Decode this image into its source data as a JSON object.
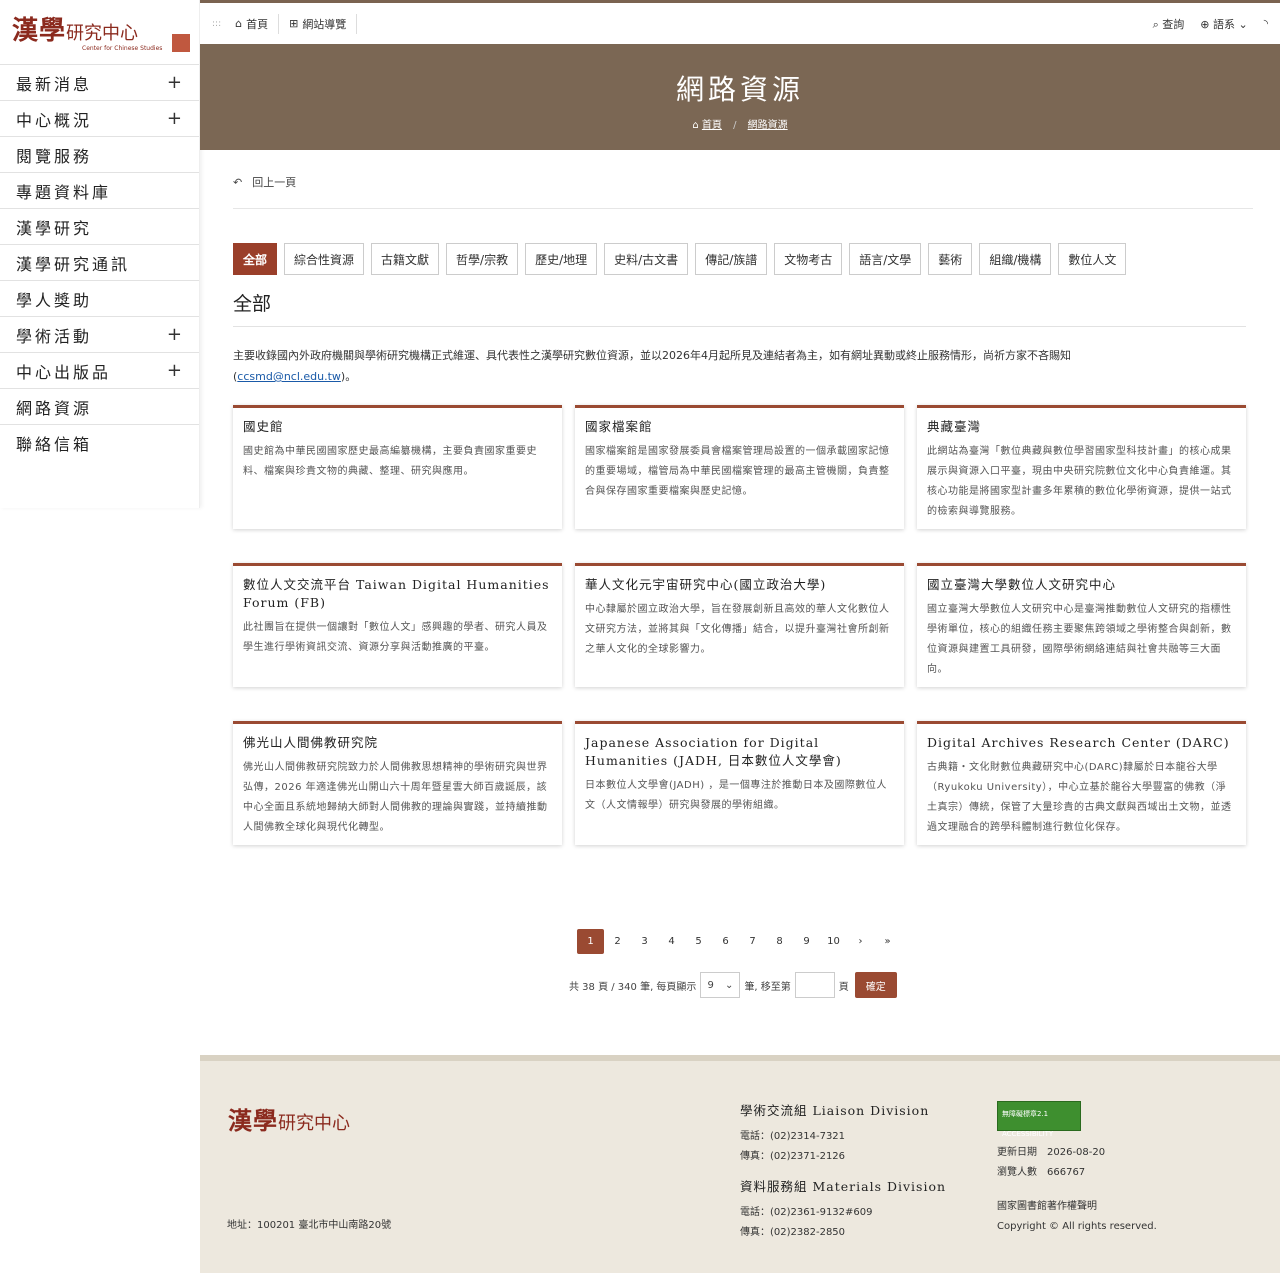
{
  "logo": {
    "zh": "漢學",
    "zh2": "研究中心",
    "en": "Center for Chinese Studies"
  },
  "sidebar": [
    {
      "label": "最新消息",
      "expand": "+"
    },
    {
      "label": "中心概況",
      "expand": "+"
    },
    {
      "label": "閱覽服務",
      "expand": ""
    },
    {
      "label": "專題資料庫",
      "expand": ""
    },
    {
      "label": "漢學研究",
      "expand": ""
    },
    {
      "label": "漢學研究通訊",
      "expand": ""
    },
    {
      "label": "學人獎助",
      "expand": ""
    },
    {
      "label": "學術活動",
      "expand": "+"
    },
    {
      "label": "中心出版品",
      "expand": "+"
    },
    {
      "label": "網路資源",
      "expand": ""
    },
    {
      "label": "聯絡信箱",
      "expand": ""
    }
  ],
  "topbar": {
    "home": "首頁",
    "sitemap": "網站導覽",
    "search": "查詢",
    "language": "語系"
  },
  "banner": {
    "title": "網路資源",
    "crumb_home": "首頁",
    "crumb_current": "網路資源"
  },
  "main": {
    "back": "回上一頁",
    "filters": [
      "全部",
      "綜合性資源",
      "古籍文獻",
      "哲學/宗教",
      "歷史/地理",
      "史料/古文書",
      "傳記/族譜",
      "文物考古",
      "語言/文學",
      "藝術",
      "組織/機構",
      "數位人文"
    ],
    "section_title": "全部",
    "intro": "主要收錄國內外政府機關與學術研究機構正式維運、具代表性之漢學研究數位資源，並以2026年4月起所見及連結者為主，如有網址異動或終止服務情形，尚祈方家不吝賜知",
    "intro_email": "ccsmd@ncl.edu.tw",
    "intro_tail": "。",
    "cards": [
      {
        "title": "國史館",
        "desc": "國史館為中華民國國家歷史最高編纂機構，主要負責國家重要史料、檔案與珍貴文物的典藏、整理、研究與應用。"
      },
      {
        "title": "國家檔案館",
        "desc": "國家檔案館是國家發展委員會檔案管理局設置的一個承載國家記憶的重要場域，檔管局為中華民國檔案管理的最高主管機關，負責整合與保存國家重要檔案與歷史記憶。"
      },
      {
        "title": "典藏臺灣",
        "desc": "此網站為臺灣「數位典藏與數位學習國家型科技計畫」的核心成果展示與資源入口平臺，現由中央研究院數位文化中心負責維運。其核心功能是將國家型計畫多年累積的數位化學術資源，提供一站式的檢索與導覽服務。"
      },
      {
        "title": "數位人文交流平台 Taiwan Digital Humanities Forum (FB)",
        "desc": "此社團旨在提供一個讓對「數位人文」感興趣的學者、研究人員及學生進行學術資訊交流、資源分享與活動推廣的平臺。"
      },
      {
        "title": "華人文化元宇宙研究中心(國立政治大學)",
        "desc": "中心隸屬於國立政治大學，旨在發展創新且高效的華人文化數位人文研究方法，並將其與「文化傳播」結合，以提升臺灣社會所創新之華人文化的全球影響力。"
      },
      {
        "title": "國立臺灣大學數位人文研究中心",
        "desc": "國立臺灣大學數位人文研究中心是臺灣推動數位人文研究的指標性學術單位，核心的組織任務主要聚焦跨領域之學術整合與創新，數位資源與建置工具研發，國際學術網絡連結與社會共融等三大面向。"
      },
      {
        "title": "佛光山人間佛教研究院",
        "desc": "佛光山人間佛教研究院致力於人間佛教思想精神的學術研究與世界弘傳，2026 年適逢佛光山開山六十周年暨星雲大師百歲誕辰，該中心全面且系統地歸納大師對人間佛教的理論與實踐，並持續推動人間佛教全球化與現代化轉型。"
      },
      {
        "title": "Japanese Association for Digital Humanities (JADH, 日本數位人文學會)",
        "desc": "日本數位人文學會(JADH) ，是一個專注於推動日本及國際數位人文（人文情報學）研究與發展的學術組織。"
      },
      {
        "title": "Digital Archives Research Center (DARC)",
        "desc": "古典籍・文化財數位典藏研究中心(DARC)隸屬於日本龍谷大學（Ryukoku University），中心立基於龍谷大學豐富的佛教（淨土真宗）傳統，保管了大量珍貴的古典文獻與西域出土文物，並透過文理融合的跨學科體制進行數位化保存。"
      }
    ]
  },
  "pager": {
    "pages": [
      "1",
      "2",
      "3",
      "4",
      "5",
      "6",
      "7",
      "8",
      "9",
      "10"
    ],
    "next": "›",
    "last": "»",
    "info_prefix": "共 38 頁 / 340 筆, 每頁顯示",
    "per_page": "9",
    "info_mid": "筆, 移至第",
    "info_suffix": "頁",
    "confirm": "確定"
  },
  "footer": {
    "address": "地址：100201 臺北市中山南路20號",
    "liaison_title": "學術交流組 Liaison Division",
    "liaison_tel": "電話：(02)2314-7321",
    "liaison_fax": "傳真：(02)2371-2126",
    "materials_title": "資料服務組 Materials Division",
    "materials_tel": "電話：(02)2361-9132#609",
    "materials_fax": "傳真：(02)2382-2850",
    "badge": "無障礙標章2.1 ACCESSIBILITY",
    "updated": "更新日期　2026-08-20",
    "visitors": "瀏覽人數　666767",
    "copyright_notice": "國家圖書館著作權聲明",
    "copyright": "Copyright © All rights reserved."
  },
  "colors": {
    "accent": "#9a4a32",
    "banner": "#7b6754",
    "footer_bg": "#ede8de"
  }
}
